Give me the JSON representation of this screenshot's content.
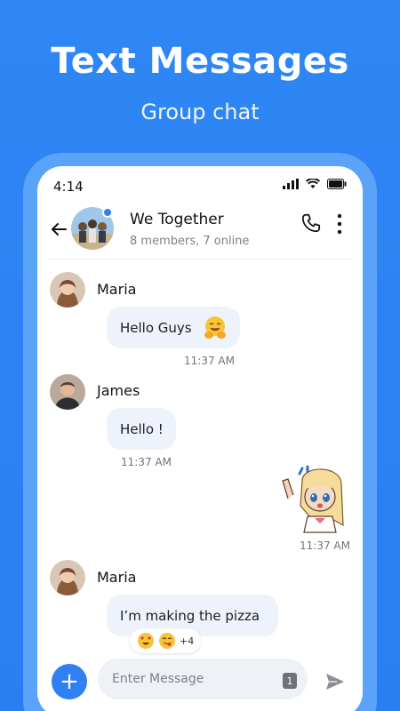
{
  "promo": {
    "title": "Text Messages",
    "subtitle": "Group chat"
  },
  "status_bar": {
    "time": "4:14"
  },
  "chat_header": {
    "group_name": "We Together",
    "group_meta": "8 members, 7 online"
  },
  "messages": [
    {
      "sender": "Maria",
      "text": "Hello Guys",
      "time": "11:37 AM",
      "emoji": "hug-emoji"
    },
    {
      "sender": "James",
      "text": "Hello !",
      "time": "11:37 AM"
    },
    {
      "sender": "me",
      "sticker": "waving-girl-sticker",
      "time": "11:37 AM"
    },
    {
      "sender": "Maria",
      "text": "I’m making the pizza",
      "reactions": [
        "heart-eyes",
        "yum"
      ],
      "reactions_extra": "+4"
    }
  ],
  "composer": {
    "placeholder": "Enter Message",
    "count": "1"
  },
  "colors": {
    "brand_blue": "#2f80f3",
    "bubble_bg": "#eef3fb",
    "input_bg": "#eef1f6"
  }
}
